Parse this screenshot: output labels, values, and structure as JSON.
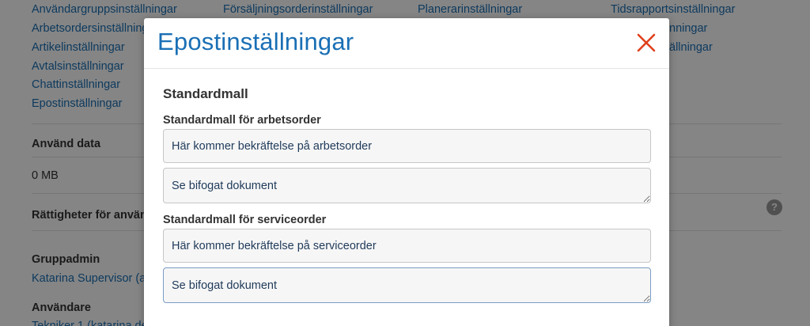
{
  "background": {
    "settings_links": [
      [
        "Användargruppsinställningar",
        "Arbetsordersinställningar",
        "Artikelinställningar",
        "Avtalsinställningar",
        "Chattinställningar",
        "Epostinställningar"
      ],
      [
        "Försäljningsorderinställningar"
      ],
      [
        "Planerarinställningar"
      ],
      [
        "Tidsrapportsinställningar",
        "nningar",
        "ällningar"
      ]
    ],
    "used_data_heading": "Använd data",
    "used_data_value": "0 MB",
    "rights_heading": "Rättigheter för använ",
    "help_icon_glyph": "?",
    "group_admin_heading": "Gruppadmin",
    "group_admin_user": "Katarina Supervisor (ad",
    "users_heading": "Användare",
    "users_first": "Tekniker 1 (katarina.de"
  },
  "modal": {
    "title": "Epostinställningar",
    "close_icon": "close-icon",
    "section_title": "Standardmall",
    "work_order": {
      "label": "Standardmall för arbetsorder",
      "subject": "Här kommer bekräftelse på arbetsorder",
      "body": "Se bifogat dokument"
    },
    "service_order": {
      "label": "Standardmall för serviceorder",
      "subject": "Här kommer bekräftelse på serviceorder",
      "body": "Se bifogat dokument"
    }
  },
  "colors": {
    "link": "#1a6fb5",
    "close": "#e0401c",
    "overlay": "rgba(0,0,0,0.48)"
  }
}
